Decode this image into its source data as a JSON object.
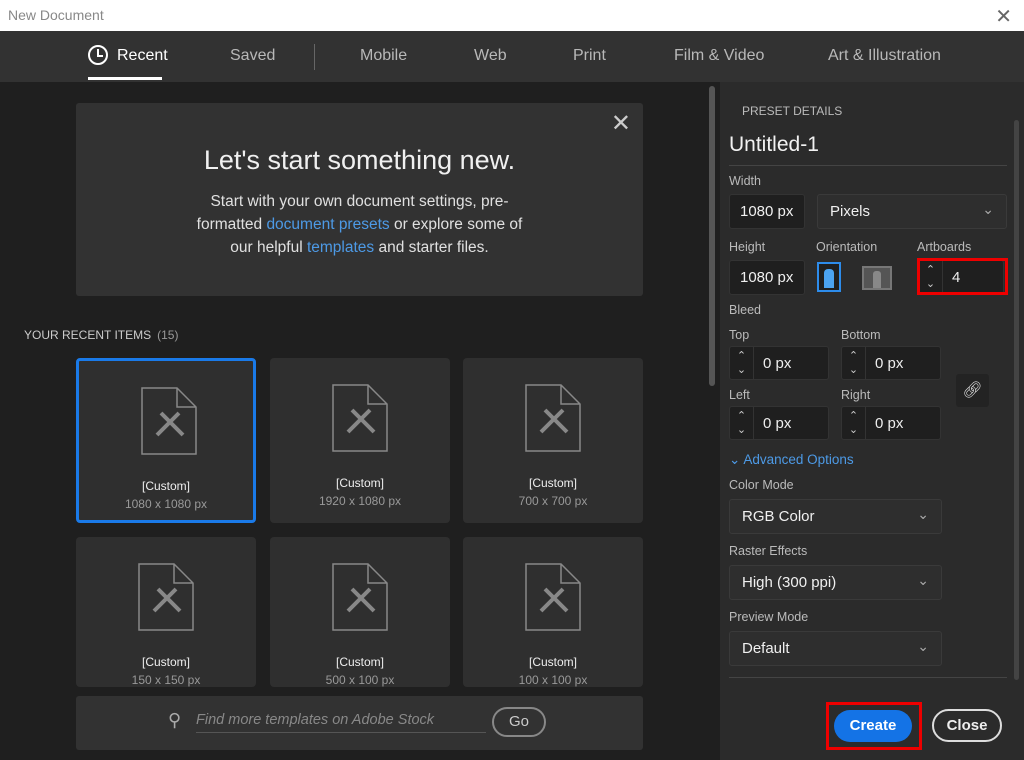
{
  "window": {
    "title": "New Document",
    "close": "✕"
  },
  "tabs": [
    "Recent",
    "Saved",
    "Mobile",
    "Web",
    "Print",
    "Film & Video",
    "Art & Illustration"
  ],
  "hero": {
    "title": "Let's start something new.",
    "t1": "Start with your own document settings, pre-formatted ",
    "link1": "document presets",
    "t2": " or explore some of our helpful ",
    "link2": "templates",
    "t3": " and starter files.",
    "close": "✕"
  },
  "recent": {
    "label": "YOUR RECENT ITEMS",
    "count": "(15)",
    "items": [
      {
        "name": "[Custom]",
        "size": "1080 x 1080 px"
      },
      {
        "name": "[Custom]",
        "size": "1920 x 1080 px"
      },
      {
        "name": "[Custom]",
        "size": "700 x 700 px"
      },
      {
        "name": "[Custom]",
        "size": "150 x 150 px"
      },
      {
        "name": "[Custom]",
        "size": "500 x 100 px"
      },
      {
        "name": "[Custom]",
        "size": "100 x 100 px"
      }
    ]
  },
  "search": {
    "placeholder": "Find more templates on Adobe Stock",
    "go": "Go"
  },
  "preset": {
    "header": "PRESET DETAILS",
    "name": "Untitled-1",
    "width_label": "Width",
    "width": "1080 px",
    "units": "Pixels",
    "height_label": "Height",
    "height": "1080 px",
    "orientation_label": "Orientation",
    "artboards_label": "Artboards",
    "artboards": "4",
    "bleed_label": "Bleed",
    "top_label": "Top",
    "top": "0 px",
    "bottom_label": "Bottom",
    "bottom": "0 px",
    "left_label": "Left",
    "left": "0 px",
    "right_label": "Right",
    "right": "0 px",
    "advanced": "Advanced Options",
    "color_mode_label": "Color Mode",
    "color_mode": "RGB Color",
    "raster_label": "Raster Effects",
    "raster": "High (300 ppi)",
    "preview_label": "Preview Mode",
    "preview": "Default"
  },
  "buttons": {
    "create": "Create",
    "close": "Close"
  }
}
